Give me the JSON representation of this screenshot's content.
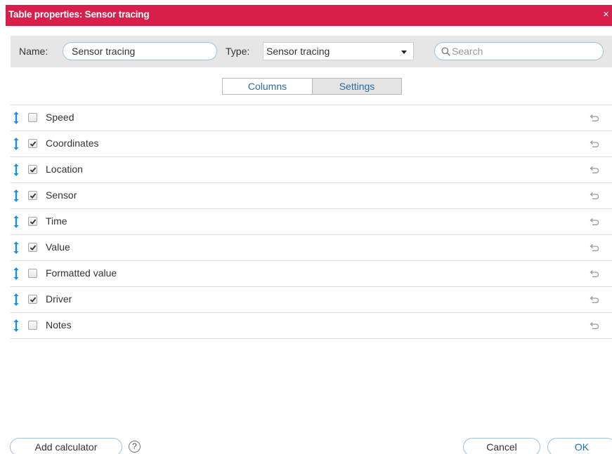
{
  "dialog": {
    "title": "Table properties: Sensor tracing",
    "close_icon": "×",
    "accent_color": "#d81e4a"
  },
  "toolbar": {
    "name_label": "Name:",
    "name_value": "Sensor tracing",
    "type_label": "Type:",
    "type_value": "Sensor tracing",
    "search_placeholder": "Search"
  },
  "tabs": [
    {
      "label": "Columns",
      "active": false
    },
    {
      "label": "Settings",
      "active": true
    }
  ],
  "columns": [
    {
      "label": "Speed",
      "checked": false
    },
    {
      "label": "Coordinates",
      "checked": true
    },
    {
      "label": "Location",
      "checked": true
    },
    {
      "label": "Sensor",
      "checked": true
    },
    {
      "label": "Time",
      "checked": true
    },
    {
      "label": "Value",
      "checked": true
    },
    {
      "label": "Formatted value",
      "checked": false
    },
    {
      "label": "Driver",
      "checked": true
    },
    {
      "label": "Notes",
      "checked": false
    }
  ],
  "footer": {
    "add_calculator_label": "Add calculator",
    "help_icon": "?",
    "cancel_label": "Cancel",
    "ok_label": "OK"
  },
  "icons": {
    "drag": "drag-handle-icon",
    "reset": "undo-icon",
    "search": "search-icon"
  }
}
